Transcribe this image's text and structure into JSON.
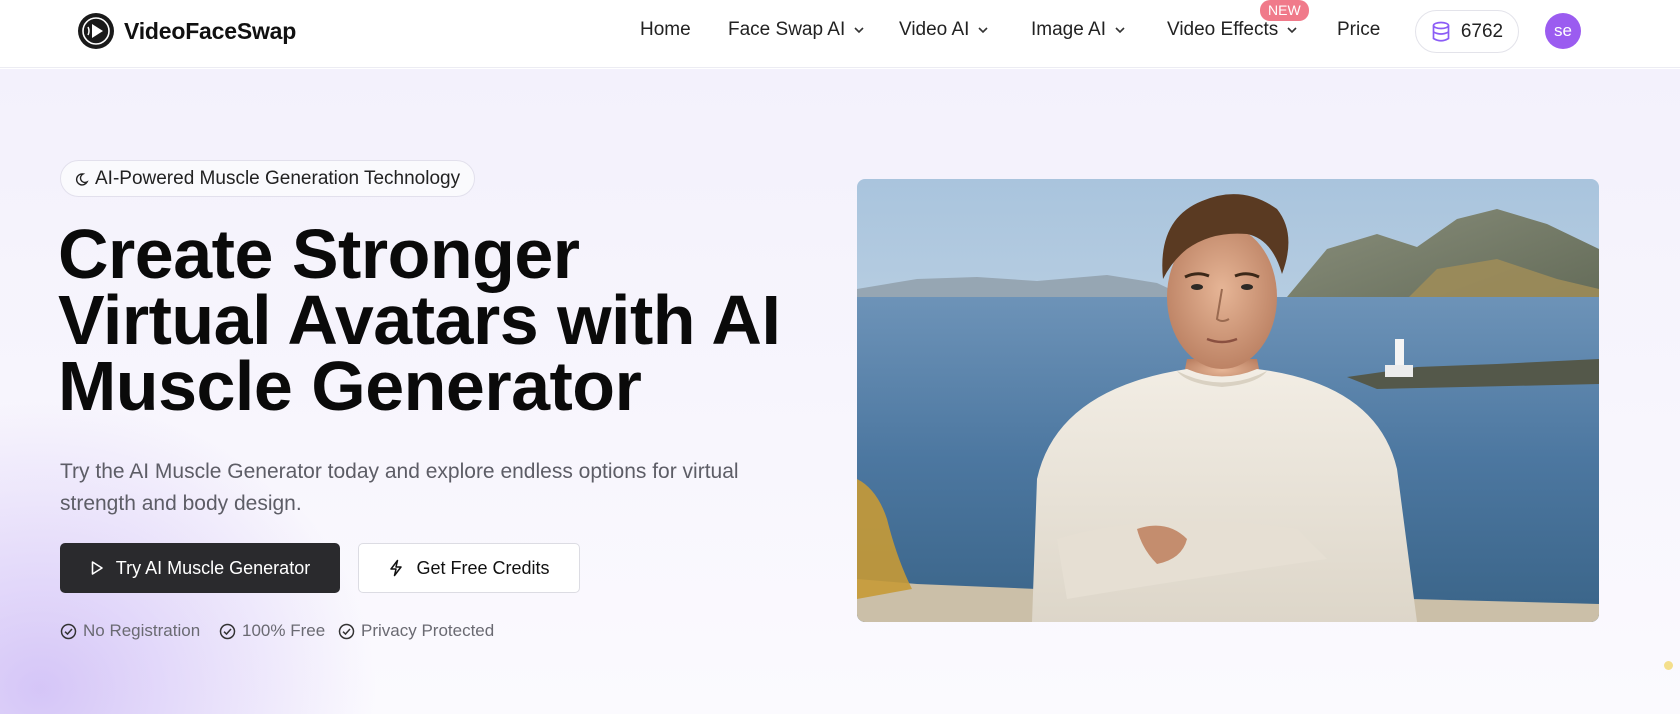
{
  "brand": {
    "name": "VideoFaceSwap",
    "logo_icon": "play-face-logo-icon"
  },
  "nav": {
    "home": "Home",
    "face_swap": "Face Swap AI",
    "video_ai": "Video AI",
    "image_ai": "Image AI",
    "video_effects": "Video Effects",
    "video_effects_badge": "NEW",
    "price": "Price",
    "credits": "6762",
    "credits_icon": "database-icon",
    "avatar_initials": "se"
  },
  "hero": {
    "tag": "AI-Powered Muscle Generation Technology",
    "tag_icon": "moon-icon",
    "headline": [
      "Create Stronger",
      "Virtual Avatars with AI",
      "Muscle Generator"
    ],
    "subtext": "Try the AI Muscle Generator today and explore endless options for virtual strength and body design.",
    "primary_button": "Try AI Muscle Generator",
    "primary_icon": "play-icon",
    "secondary_button": "Get Free Credits",
    "secondary_icon": "lightning-icon",
    "features": [
      "No Registration",
      "100% Free",
      "Privacy Protected"
    ],
    "feature_icon": "check-circle-icon"
  },
  "colors": {
    "accent": "#9b5cf0",
    "badge": "#f07a8a",
    "primary_button": "#2a2a2d"
  }
}
